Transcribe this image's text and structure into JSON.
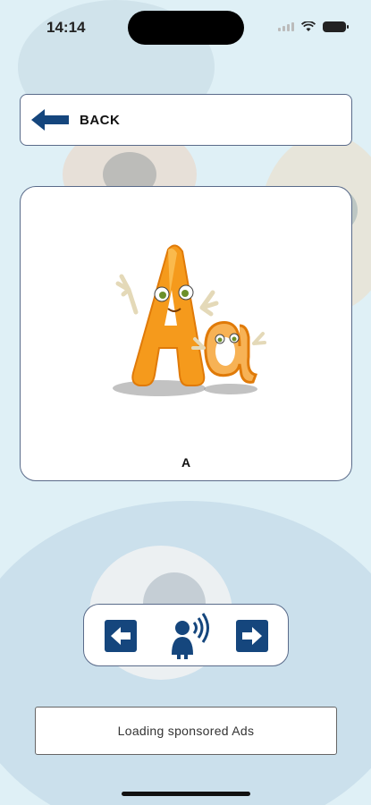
{
  "status_bar": {
    "time": "14:14"
  },
  "back_button": {
    "label": "BACK"
  },
  "card": {
    "letter": "A"
  },
  "ad_banner": {
    "text": "Loading sponsored Ads"
  },
  "colors": {
    "accent": "#15467d",
    "border": "#5a6b8a",
    "letter_orange": "#f59a1c"
  },
  "icons": {
    "back": "left-arrow-icon",
    "previous": "left-arrow-square-icon",
    "speak": "speaking-person-icon",
    "next": "right-arrow-square-icon"
  }
}
